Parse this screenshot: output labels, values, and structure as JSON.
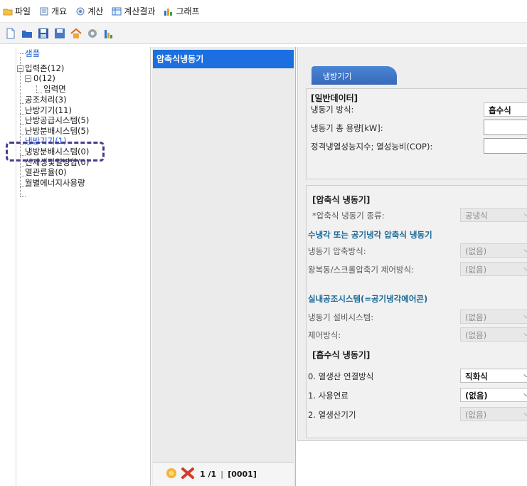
{
  "menu": {
    "items": [
      {
        "label": "파일",
        "icon": "folder-icon"
      },
      {
        "label": "개요",
        "icon": "document-icon"
      },
      {
        "label": "계산",
        "icon": "calculate-icon"
      },
      {
        "label": "계산결과",
        "icon": "table-icon"
      },
      {
        "label": "그래프",
        "icon": "bar-chart-icon"
      }
    ]
  },
  "toolbar": {
    "buttons": [
      "new-file-icon",
      "open-folder-icon",
      "save-icon",
      "save-as-icon",
      "home-icon",
      "settings-icon",
      "chart-icon"
    ]
  },
  "tree": {
    "root": "샘플",
    "zones": "입력존(12)",
    "zone0": "0(12)",
    "surface": "입력면",
    "ahu": "공조처리(3)",
    "heating": "난방기기(11)",
    "heat_supply": "난방공급시스템(5)",
    "heat_dist": "난방분배시스템(5)",
    "cooling": "냉방기기(1)",
    "cool_dist": "냉방분배시스템(0)",
    "renewable": "신재생및열병합(0)",
    "heat_flow": "열관류율(0)",
    "monthly": "월별에너지사용량"
  },
  "list": {
    "selected": "압축식냉동기",
    "pager": "1 /1",
    "code": "[0001]"
  },
  "detail": {
    "tab": "냉방기기",
    "general": {
      "title": "[일반데이터]",
      "type_label": "냉동기 방식:",
      "type_value": "흡수식",
      "capacity_label": "냉동기 총 용량[kW]:",
      "cop_label": "정격냉열성능지수; 열성능비(COP):"
    },
    "compression": {
      "title": "[압축식 냉동기]",
      "kind_label": "*압축식 냉동기 종류:",
      "kind_value": "공냉식",
      "water_air_header": "수냉각 또는 공기냉각 압축식 냉동기",
      "compress_label": "냉동기 압축방식:",
      "compress_value": "(없음)",
      "control_label": "왕복동/스크롤압축기 제어방식:",
      "control_value": "(없음)",
      "indoor_header": "실내공조시스템(=공기냉각에어콘)",
      "equip_label": "냉동기 설비시스템:",
      "equip_value": "(없음)",
      "ctrl_label": "제어방식:",
      "ctrl_value": "(없음)"
    },
    "absorption": {
      "title": "[흡수식 냉동기]",
      "conn_label": "0. 열생산 연결방식",
      "conn_value": "직화식",
      "fuel_label": "1. 사용연료",
      "fuel_value": "(없음)",
      "gen_label": "2. 열생산기기",
      "gen_value": "(없음)"
    }
  }
}
